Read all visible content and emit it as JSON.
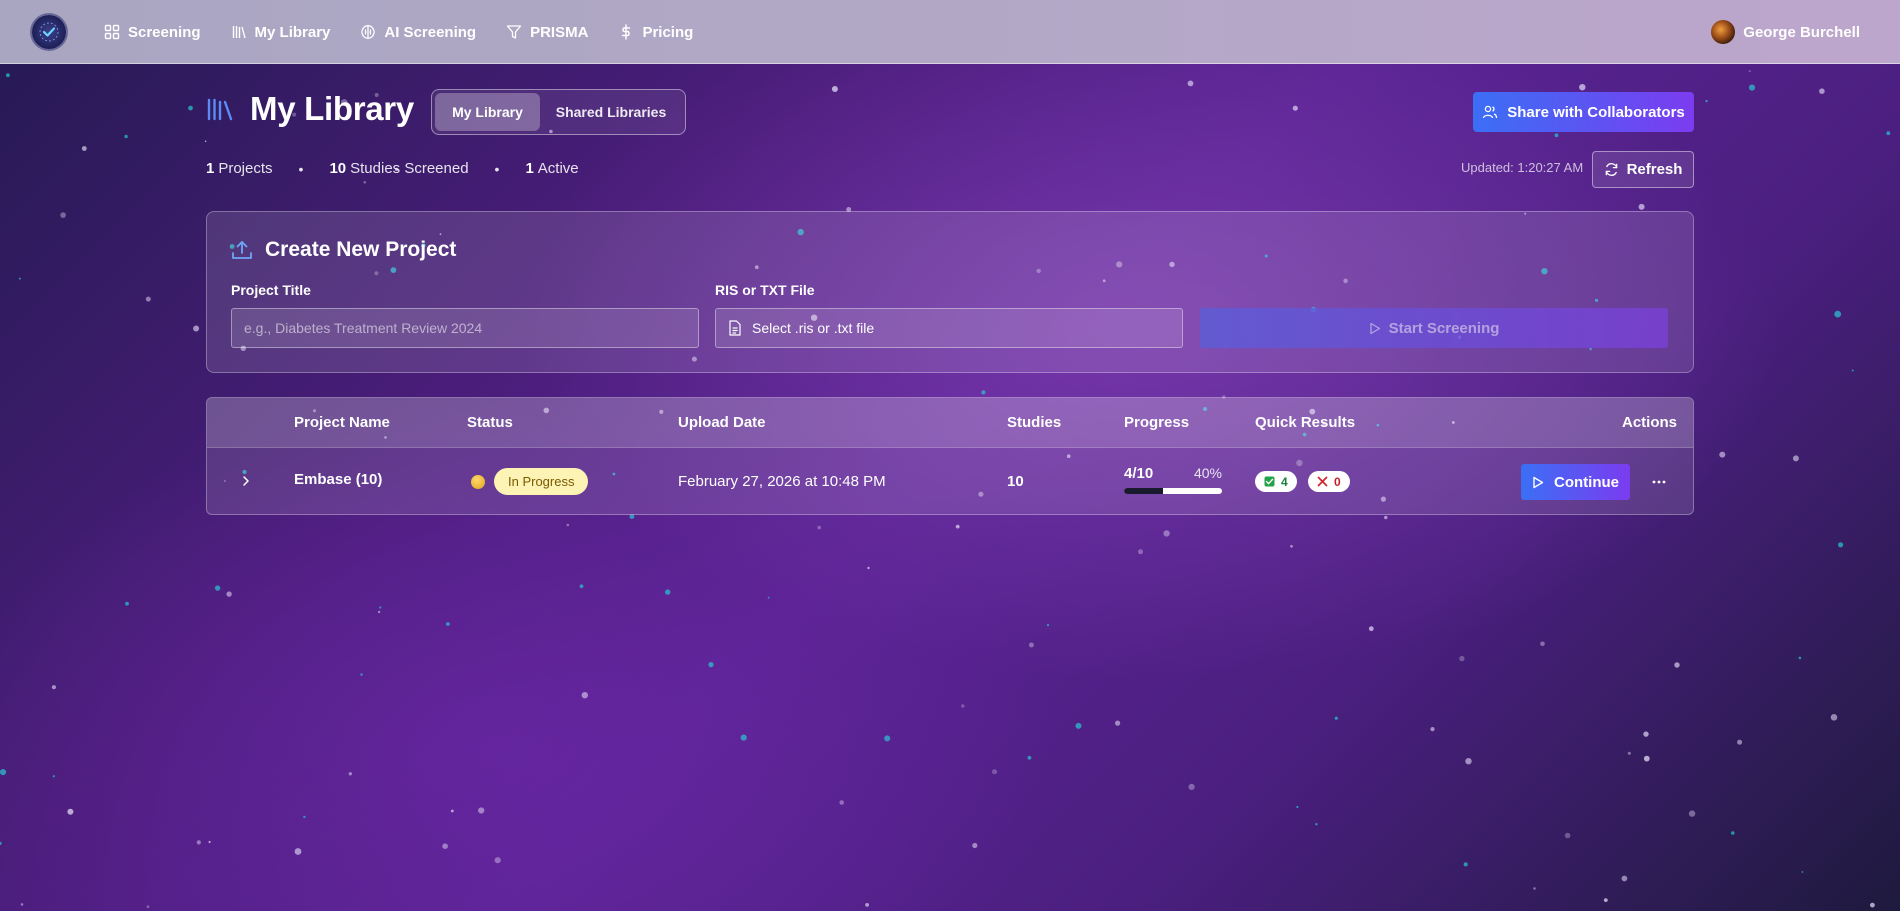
{
  "nav": {
    "items": [
      {
        "label": "Screening",
        "icon": "grid-icon"
      },
      {
        "label": "My Library",
        "icon": "library-icon"
      },
      {
        "label": "AI Screening",
        "icon": "brain-icon"
      },
      {
        "label": "PRISMA",
        "icon": "filter-icon"
      },
      {
        "label": "Pricing",
        "icon": "dollar-icon"
      }
    ],
    "user_name": "George Burchell"
  },
  "header": {
    "title": "My Library",
    "tabs": [
      {
        "label": "My Library",
        "active": true
      },
      {
        "label": "Shared Libraries",
        "active": false
      }
    ],
    "share_label": "Share with Collaborators",
    "stats": {
      "projects_count": "1",
      "projects_label": "Projects",
      "studies_count": "10",
      "studies_label": "Studies Screened",
      "active_count": "1",
      "active_label": "Active"
    },
    "updated_text": "Updated: 1:20:27 AM",
    "refresh_label": "Refresh"
  },
  "create_project": {
    "title": "Create New Project",
    "project_title_label": "Project Title",
    "project_title_placeholder": "e.g., Diabetes Treatment Review 2024",
    "file_label": "RIS or TXT File",
    "file_button_text": "Select .ris or .txt file",
    "start_label": "Start Screening"
  },
  "table": {
    "columns": [
      "Project Name",
      "Status",
      "Upload Date",
      "Studies",
      "Progress",
      "Quick Results",
      "Actions"
    ],
    "rows": [
      {
        "name": "Embase (10)",
        "status": "In Progress",
        "upload_date": "February 27, 2026 at 10:48 PM",
        "studies": "10",
        "progress_text": "4/10",
        "progress_pct": "40%",
        "progress_fraction": 0.4,
        "included": "4",
        "excluded": "0",
        "action_label": "Continue"
      }
    ]
  },
  "colors": {
    "accent_start": "#3b6ff5",
    "accent_end": "#7b3cf0",
    "status_badge_bg": "#fdf3b5",
    "included_color": "#1b7f3a",
    "excluded_color": "#c0202a"
  }
}
